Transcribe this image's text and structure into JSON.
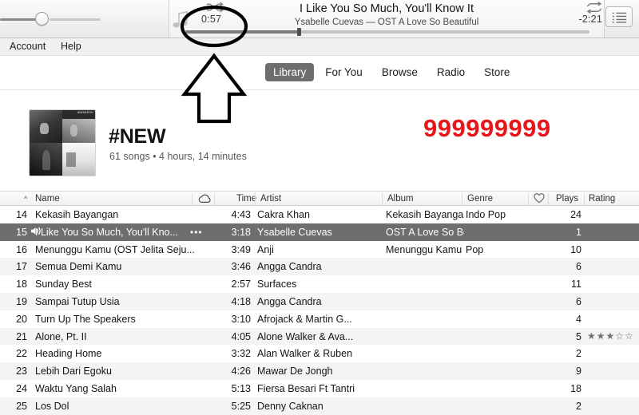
{
  "player": {
    "elapsed": "0:57",
    "remaining": "-2:21",
    "track_title": "I Like You So Much, You'll Know It",
    "track_subtitle": "Ysabelle Cuevas — OST A Love So Beautiful",
    "volume_percent": 48,
    "progress_percent": 28,
    "shuffle_icon": "shuffle-icon",
    "repeat_icon": "repeat-icon",
    "note_icon": "music-note-icon",
    "queue_icon": "queue-list-icon"
  },
  "menubar": {
    "items": [
      {
        "label": "Account"
      },
      {
        "label": "Help"
      }
    ]
  },
  "nav": {
    "tabs": [
      {
        "label": "Library",
        "active": true
      },
      {
        "label": "For You",
        "active": false
      },
      {
        "label": "Browse",
        "active": false
      },
      {
        "label": "Radio",
        "active": false
      },
      {
        "label": "Store",
        "active": false
      }
    ]
  },
  "playlist": {
    "title": "#NEW",
    "subtitle": "61 songs • 4 hours, 14 minutes",
    "artwork_label": "ANOMESH"
  },
  "annotations": {
    "red_number": "999999999",
    "red_color": "#e8161a",
    "ellipse_target": "elapsed-time",
    "arrow_direction": "up"
  },
  "table": {
    "columns": [
      {
        "key": "name",
        "label": "Name"
      },
      {
        "key": "cloud",
        "label": "",
        "icon": "cloud-icon"
      },
      {
        "key": "time",
        "label": "Time"
      },
      {
        "key": "artist",
        "label": "Artist"
      },
      {
        "key": "album",
        "label": "Album"
      },
      {
        "key": "genre",
        "label": "Genre"
      },
      {
        "key": "love",
        "label": "",
        "icon": "heart-icon"
      },
      {
        "key": "plays",
        "label": "Plays"
      },
      {
        "key": "rating",
        "label": "Rating"
      }
    ],
    "rows": [
      {
        "index": "14",
        "name": "Kekasih Bayangan",
        "time": "4:43",
        "artist": "Cakra Khan",
        "album": "Kekasih Bayangan -...",
        "genre": "Indo Pop",
        "plays": "24",
        "rating": "",
        "selected": false,
        "playing": false
      },
      {
        "index": "15",
        "name": "I Like You So Much, You'll Kno...",
        "time": "3:18",
        "artist": "Ysabelle Cuevas",
        "album": "OST A Love So Beau...",
        "genre": "",
        "plays": "1",
        "rating": "",
        "selected": true,
        "playing": true,
        "overflow": "•••"
      },
      {
        "index": "16",
        "name": "Menunggu Kamu (OST Jelita Seju...",
        "time": "3:49",
        "artist": "Anji",
        "album": "Menunggu Kamu (...",
        "genre": "Pop",
        "plays": "10",
        "rating": "",
        "selected": false,
        "playing": false
      },
      {
        "index": "17",
        "name": "Semua Demi Kamu",
        "time": "3:46",
        "artist": "Angga Candra",
        "album": "",
        "genre": "",
        "plays": "6",
        "rating": "",
        "selected": false,
        "playing": false
      },
      {
        "index": "18",
        "name": "Sunday Best",
        "time": "2:57",
        "artist": "Surfaces",
        "album": "",
        "genre": "",
        "plays": "11",
        "rating": "",
        "selected": false,
        "playing": false
      },
      {
        "index": "19",
        "name": "Sampai Tutup Usia",
        "time": "4:18",
        "artist": "Angga Candra",
        "album": "",
        "genre": "",
        "plays": "6",
        "rating": "",
        "selected": false,
        "playing": false
      },
      {
        "index": "20",
        "name": "Turn Up The Speakers",
        "time": "3:10",
        "artist": "Afrojack & Martin G...",
        "album": "",
        "genre": "",
        "plays": "4",
        "rating": "",
        "selected": false,
        "playing": false
      },
      {
        "index": "21",
        "name": "Alone, Pt. II",
        "time": "4:05",
        "artist": "Alone Walker & Ava...",
        "album": "",
        "genre": "",
        "plays": "5",
        "rating": "★★★☆☆",
        "selected": false,
        "playing": false
      },
      {
        "index": "22",
        "name": "Heading Home",
        "time": "3:32",
        "artist": "Alan Walker & Ruben",
        "album": "",
        "genre": "",
        "plays": "2",
        "rating": "",
        "selected": false,
        "playing": false
      },
      {
        "index": "23",
        "name": "Lebih Dari Egoku",
        "time": "4:26",
        "artist": "Mawar De Jongh",
        "album": "",
        "genre": "",
        "plays": "9",
        "rating": "",
        "selected": false,
        "playing": false
      },
      {
        "index": "24",
        "name": "Waktu Yang Salah",
        "time": "5:13",
        "artist": "Fiersa Besari Ft Tantri",
        "album": "",
        "genre": "",
        "plays": "18",
        "rating": "",
        "selected": false,
        "playing": false
      },
      {
        "index": "25",
        "name": "Los Dol",
        "time": "5:25",
        "artist": "Denny Caknan",
        "album": "",
        "genre": "",
        "plays": "2",
        "rating": "",
        "selected": false,
        "playing": false
      }
    ]
  }
}
